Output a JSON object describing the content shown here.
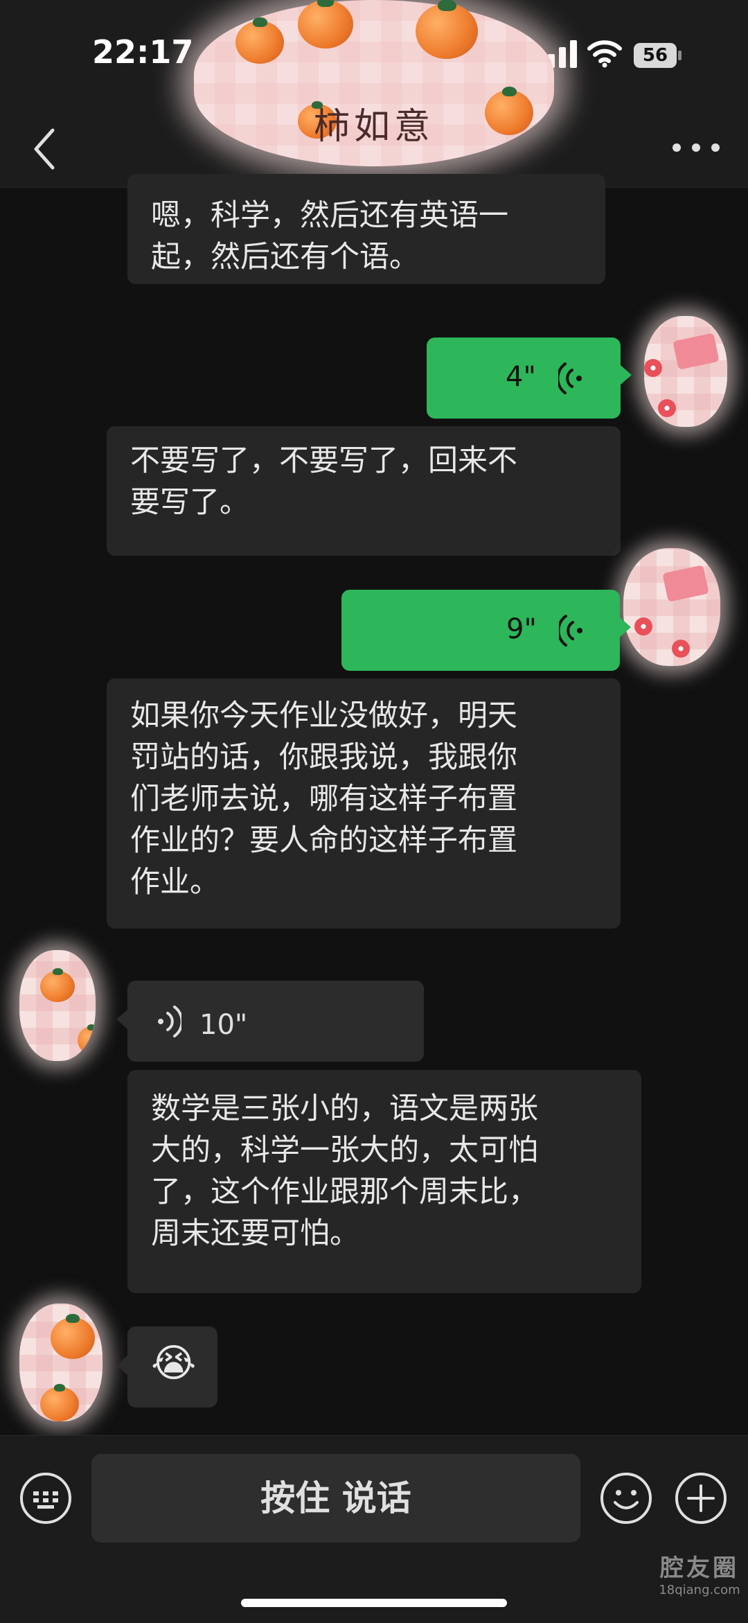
{
  "status_bar": {
    "time": "22:17",
    "battery_level": "56",
    "icons": [
      "signal-icon",
      "wifi-icon",
      "battery-icon"
    ]
  },
  "nav": {
    "title": "柿如意",
    "back_icon": "chevron-left-icon",
    "more_icon": "more-icon"
  },
  "messages": [
    {
      "side": "in",
      "type": "text",
      "text": "嗯，科学，然后还有英语一起，然后还有个语。"
    },
    {
      "side": "out",
      "type": "voice",
      "duration": "4\""
    },
    {
      "side": "in",
      "type": "text",
      "text": "不要写了，不要写了，回来不要写了。"
    },
    {
      "side": "out",
      "type": "voice",
      "duration": "9\""
    },
    {
      "side": "in",
      "type": "text",
      "text": "如果你今天作业没做好，明天罚站的话，你跟我说，我跟你们老师去说，哪有这样子布置作业的？要人命的这样子布置作业。"
    },
    {
      "side": "in",
      "type": "voice",
      "duration": "10\""
    },
    {
      "side": "in",
      "type": "text",
      "text": "数学是三张小的，语文是两张大的，科学一张大的，太可怕了，这个作业跟那个周末比，周末还要可怕。"
    },
    {
      "side": "in",
      "type": "emoji",
      "text": "😭"
    }
  ],
  "lines": {
    "m0": [
      "嗯，科学，然后还有英语一",
      "起，然后还有个语。"
    ],
    "m2": [
      "不要写了，不要写了，回来不",
      "要写了。"
    ],
    "m4": [
      "如果你今天作业没做好，明天",
      "罚站的话，你跟我说，我跟你",
      "们老师去说，哪有这样子布置",
      "作业的？要人命的这样子布置",
      "作业。"
    ],
    "m6": [
      "数学是三张小的，语文是两张",
      "大的，科学一张大的，太可怕",
      "了，这个作业跟那个周末比，",
      "周末还要可怕。"
    ]
  },
  "input_bar": {
    "talk_label": "按住 说话",
    "icons": [
      "keyboard-icon",
      "emoji-icon",
      "plus-icon"
    ]
  },
  "watermark": {
    "name": "腔友圈",
    "url": "18qiang.com"
  },
  "colors": {
    "background": "#111111",
    "bubble_out": "#2db65a",
    "bubble_in": "#262626",
    "bar": "#1c1c1c"
  }
}
